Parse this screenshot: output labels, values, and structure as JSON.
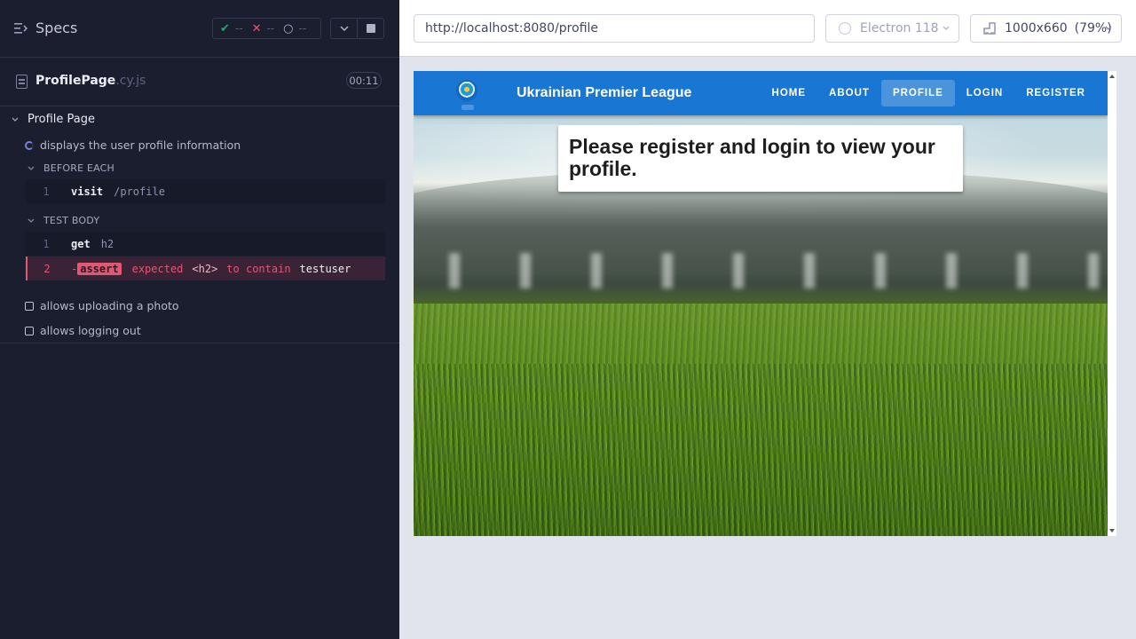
{
  "reporter": {
    "title": "Specs",
    "stats": {
      "passed": {
        "symbol": "✔",
        "count": "--"
      },
      "failed": {
        "symbol": "✕",
        "count": "--"
      },
      "pending": {
        "symbol": "○",
        "count": "--"
      }
    },
    "file": {
      "name": "ProfilePage",
      "ext": ".cy.js",
      "duration": "00:11"
    },
    "suite": "Profile Page",
    "tests": [
      {
        "title": "displays the user profile information",
        "state": "running",
        "before_each_label": "BEFORE EACH",
        "before_each": [
          {
            "num": "1",
            "name": "visit",
            "arg": "/profile"
          }
        ],
        "body_label": "TEST BODY",
        "body": [
          {
            "num": "1",
            "name": "get",
            "arg": "h2"
          },
          {
            "num": "2",
            "dash": "-",
            "name": "assert",
            "parts": {
              "expected": "expected",
              "subject": "<h2>",
              "verb": "to contain",
              "value": "testuser"
            }
          }
        ]
      },
      {
        "title": "allows uploading a photo",
        "state": "pending"
      },
      {
        "title": "allows logging out",
        "state": "pending"
      }
    ]
  },
  "runner": {
    "url": "http://localhost:8080/profile",
    "browser": "Electron 118",
    "viewport": "1000x660",
    "scale": "(79%)"
  },
  "app": {
    "title": "Ukrainian Premier League",
    "nav": [
      "HOME",
      "ABOUT",
      "PROFILE",
      "LOGIN",
      "REGISTER"
    ],
    "active_nav": "PROFILE",
    "message": "Please register and login to view your profile."
  },
  "colors": {
    "reporter_bg": "#1b1e2e",
    "app_bar": "#1976d2",
    "pass": "#1fa971",
    "fail": "#e45770",
    "running": "#7b7fde"
  },
  "icons": {
    "specs": "specs-list-icon",
    "file": "file-icon",
    "stop": "stop-icon",
    "browser": "electron-icon",
    "viewport": "viewport-ruler-icon"
  }
}
